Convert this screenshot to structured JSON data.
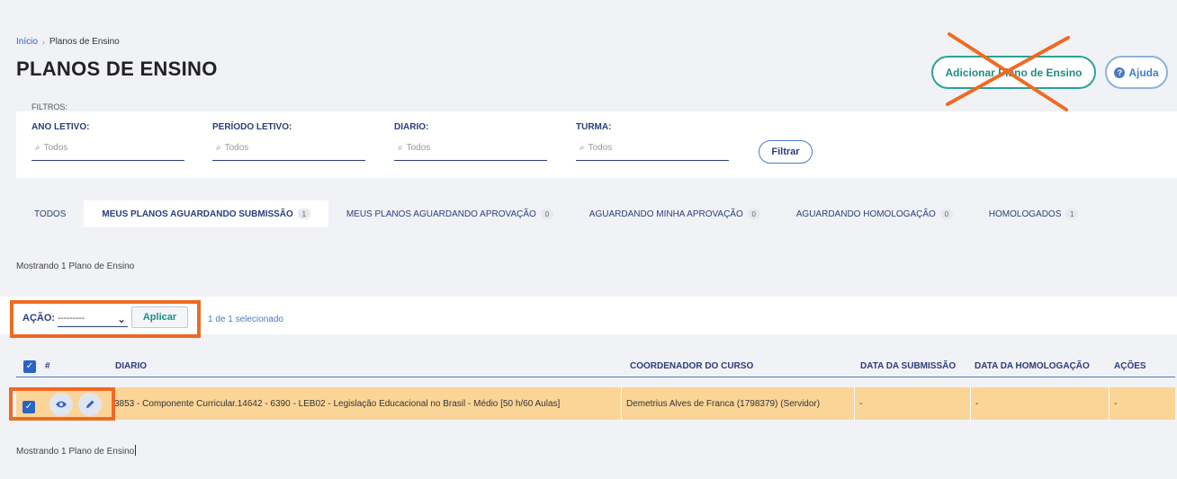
{
  "breadcrumb": {
    "home": "Início",
    "current": "Planos de Ensino"
  },
  "page": {
    "title": "PLANOS DE ENSINO"
  },
  "header_buttons": {
    "add_label": "Adicionar Plano de Ensino",
    "help_label": "Ajuda"
  },
  "filters": {
    "label": "FILTROS:",
    "ano_letivo": {
      "label": "ANO LETIVO:",
      "placeholder": "Todos"
    },
    "periodo_letivo": {
      "label": "PERÍODO LETIVO:",
      "placeholder": "Todos"
    },
    "diario": {
      "label": "DIARIO:",
      "placeholder": "Todos"
    },
    "turma": {
      "label": "TURMA:",
      "placeholder": "Todos"
    },
    "filter_button": "Filtrar"
  },
  "tabs": [
    {
      "label": "TODOS",
      "count": ""
    },
    {
      "label": "MEUS PLANOS AGUARDANDO SUBMISSÃO",
      "count": "1"
    },
    {
      "label": "MEUS PLANOS AGUARDANDO APROVAÇÃO",
      "count": "0"
    },
    {
      "label": "AGUARDANDO MINHA APROVAÇÃO",
      "count": "0"
    },
    {
      "label": "AGUARDANDO HOMOLOGAÇÃO",
      "count": "0"
    },
    {
      "label": "HOMOLOGADOS",
      "count": "1"
    }
  ],
  "results": {
    "count_text": "Mostrando 1 Plano de Ensino",
    "count_text_bottom": "Mostrando 1 Plano de Ensino"
  },
  "action": {
    "label": "AÇÃO:",
    "selected": "---------",
    "apply_label": "Aplicar",
    "selection_info": "1 de 1 selecionado"
  },
  "table": {
    "headers": {
      "number": "#",
      "diario": "DIARIO",
      "coordenador": "COORDENADOR DO CURSO",
      "submissao": "DATA DA SUBMISSÃO",
      "homologacao": "DATA DA HOMOLOGAÇÃO",
      "acoes": "AÇÕES"
    },
    "rows": [
      {
        "diario": "3853 - Componente Curricular.14642 - 6390 - LEB02 - Legislação Educacional no Brasil - Médio [50 h/60 Aulas]",
        "coordenador": "Demetrius Alves de Franca (1798379) (Servidor)",
        "submissao": "-",
        "homologacao": "-",
        "acoes": "-"
      }
    ]
  },
  "colors": {
    "accent": "#29a397",
    "primary": "#2a3e7a",
    "highlight": "#f06a23",
    "row_selected": "#fbd598"
  }
}
